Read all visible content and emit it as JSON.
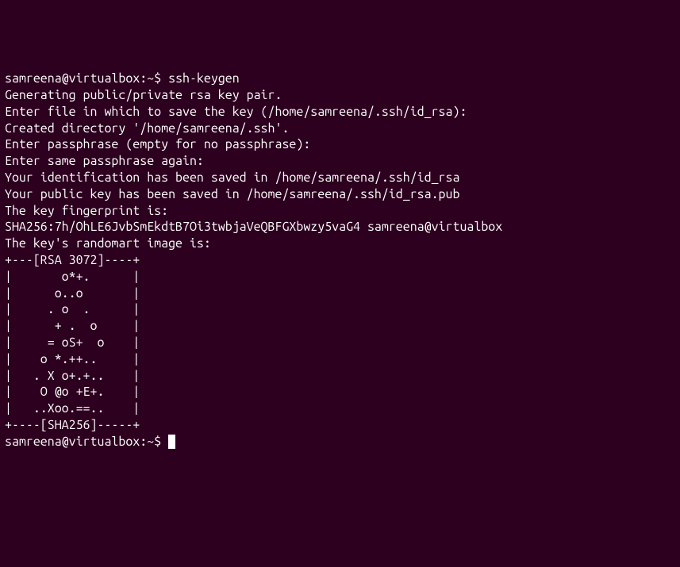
{
  "terminal": {
    "prompt1_user": "samreena@virtualbox",
    "prompt1_sep": ":",
    "prompt1_path": "~",
    "prompt1_dollar": "$ ",
    "command1": "ssh-keygen",
    "lines": [
      "Generating public/private rsa key pair.",
      "Enter file in which to save the key (/home/samreena/.ssh/id_rsa):",
      "Created directory '/home/samreena/.ssh'.",
      "Enter passphrase (empty for no passphrase):",
      "Enter same passphrase again:",
      "Your identification has been saved in /home/samreena/.ssh/id_rsa",
      "Your public key has been saved in /home/samreena/.ssh/id_rsa.pub",
      "The key fingerprint is:",
      "SHA256:7h/OhLE6JvbSmEkdtB7Oi3twbjaVeQBFGXbwzy5vaG4 samreena@virtualbox",
      "The key's randomart image is:",
      "+---[RSA 3072]----+",
      "|       o*+.      |",
      "|      o..o       |",
      "|     . o  .      |",
      "|      + .  o     |",
      "|     = oS+  o    |",
      "|    o *.++..     |",
      "|   . X o+.+..    |",
      "|    O @o +E+.    |",
      "|   ..Xoo.==..    |",
      "+----[SHA256]-----+"
    ],
    "prompt2_user": "samreena@virtualbox",
    "prompt2_sep": ":",
    "prompt2_path": "~",
    "prompt2_dollar": "$ "
  }
}
